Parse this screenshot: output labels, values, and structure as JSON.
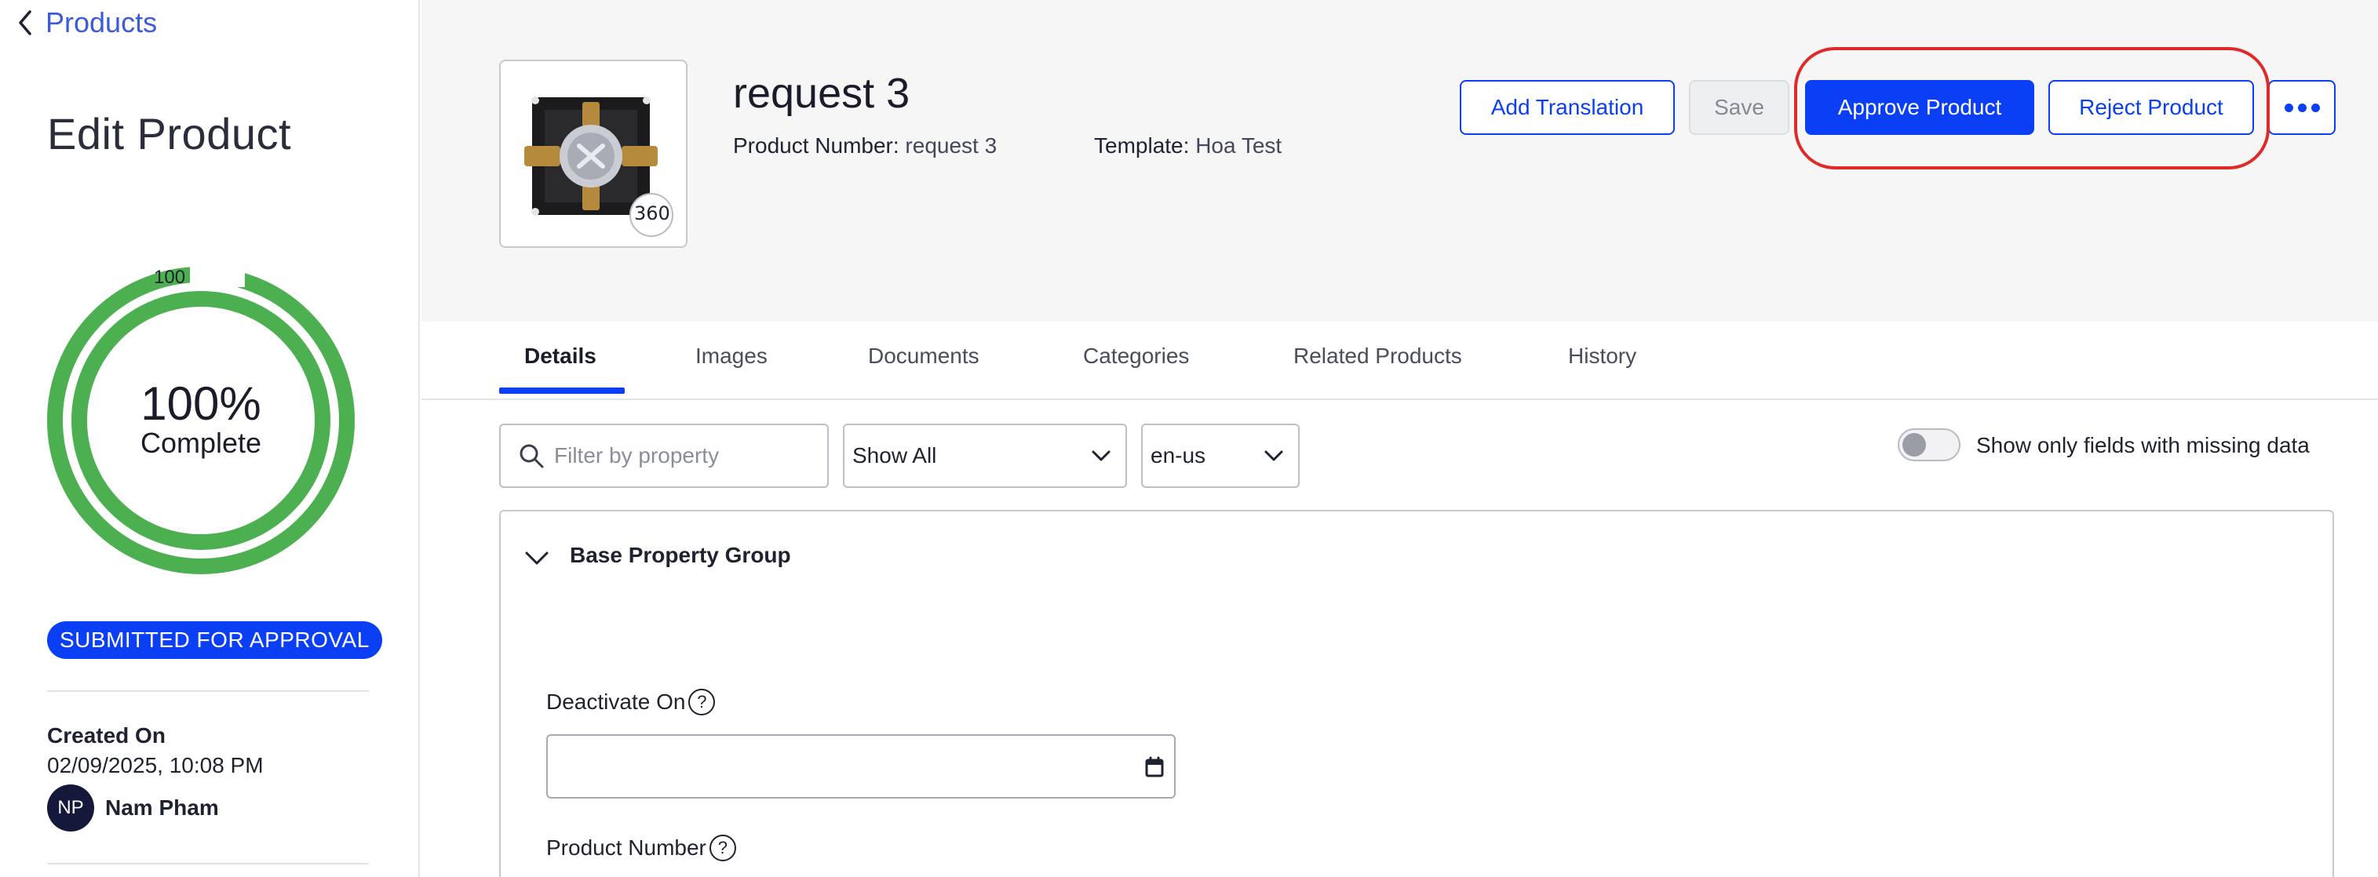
{
  "sidebar": {
    "back_label": "Products",
    "page_title": "Edit Product",
    "completion": {
      "percent": 100,
      "tick_label": "100",
      "percent_label": "100%",
      "sub_label": "Complete"
    },
    "status_badge": "SUBMITTED FOR APPROVAL",
    "created_label": "Created On",
    "created_date": "02/09/2025, 10:08 PM",
    "user": {
      "initials": "NP",
      "name": "Nam Pham"
    }
  },
  "header": {
    "product_image_icon": "shower-valve-image",
    "badge_360": "360",
    "product_title": "request 3",
    "product_number_label": "Product Number:",
    "product_number_value": "request 3",
    "template_label": "Template:",
    "template_value": "Hoa Test",
    "buttons": {
      "add_translation": "Add Translation",
      "save": "Save",
      "approve": "Approve Product",
      "reject": "Reject Product"
    },
    "more_icon": "more-horizontal-icon"
  },
  "tabs": [
    {
      "label": "Details",
      "active": true
    },
    {
      "label": "Images",
      "active": false
    },
    {
      "label": "Documents",
      "active": false
    },
    {
      "label": "Categories",
      "active": false
    },
    {
      "label": "Related Products",
      "active": false
    },
    {
      "label": "History",
      "active": false
    }
  ],
  "filters": {
    "search_placeholder": "Filter by property",
    "show_select": "Show All",
    "locale_select": "en-us",
    "toggle_label": "Show only fields with missing data",
    "toggle_on": false
  },
  "property_group": {
    "title": "Base Property Group",
    "expanded": true,
    "fields": [
      {
        "label": "Deactivate On",
        "help": "?",
        "value": ""
      },
      {
        "label": "Product Number",
        "help": "?"
      }
    ]
  },
  "colors": {
    "primary": "#0a3ff5",
    "donut": "#4caf50",
    "highlight": "#e02a2a",
    "avatar": "#15183a"
  }
}
